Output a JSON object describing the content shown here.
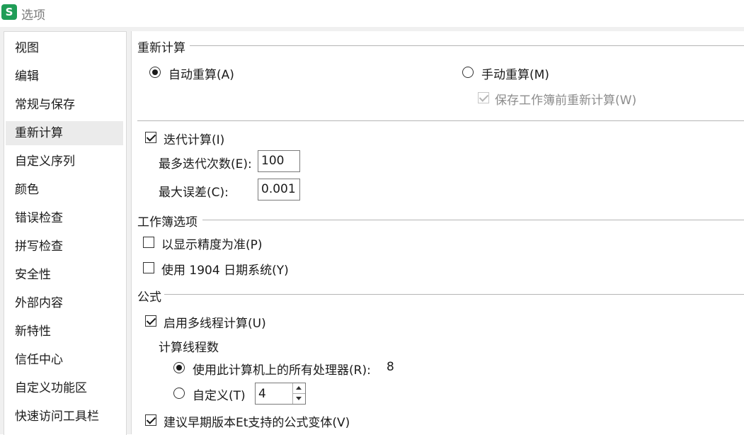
{
  "window": {
    "app_icon_letter": "S",
    "title": "选项"
  },
  "sidebar": {
    "items": [
      {
        "label": "视图"
      },
      {
        "label": "编辑"
      },
      {
        "label": "常规与保存"
      },
      {
        "label": "重新计算",
        "selected": true
      },
      {
        "label": "自定义序列"
      },
      {
        "label": "颜色"
      },
      {
        "label": "错误检查"
      },
      {
        "label": "拼写检查"
      },
      {
        "label": "安全性"
      },
      {
        "label": "外部内容"
      },
      {
        "label": "新特性"
      },
      {
        "label": "信任中心"
      },
      {
        "label": "自定义功能区"
      },
      {
        "label": "快速访问工具栏"
      }
    ]
  },
  "recalc": {
    "title": "重新计算",
    "auto_label": "自动重算(A)",
    "manual_label": "手动重算(M)",
    "save_before_label": "保存工作簿前重新计算(W)",
    "mode": "auto"
  },
  "iteration": {
    "label": "迭代计算(I)",
    "checked": true,
    "max_iter_label": "最多迭代次数(E):",
    "max_iter_value": "100",
    "max_error_label": "最大误差(C):",
    "max_error_value": "0.001"
  },
  "workbook": {
    "title": "工作簿选项",
    "precision_label": "以显示精度为准(P)",
    "date1904_label": "使用 1904 日期系统(Y)"
  },
  "formula": {
    "title": "公式",
    "multithread_label": "启用多线程计算(U)",
    "threads_title": "计算线程数",
    "all_processors_label": "使用此计算机上的所有处理器(R):",
    "processor_count": "8",
    "custom_label": "自定义(T)",
    "custom_value": "4",
    "legacy_label": "建议早期版本Et支持的公式变体(V)"
  }
}
